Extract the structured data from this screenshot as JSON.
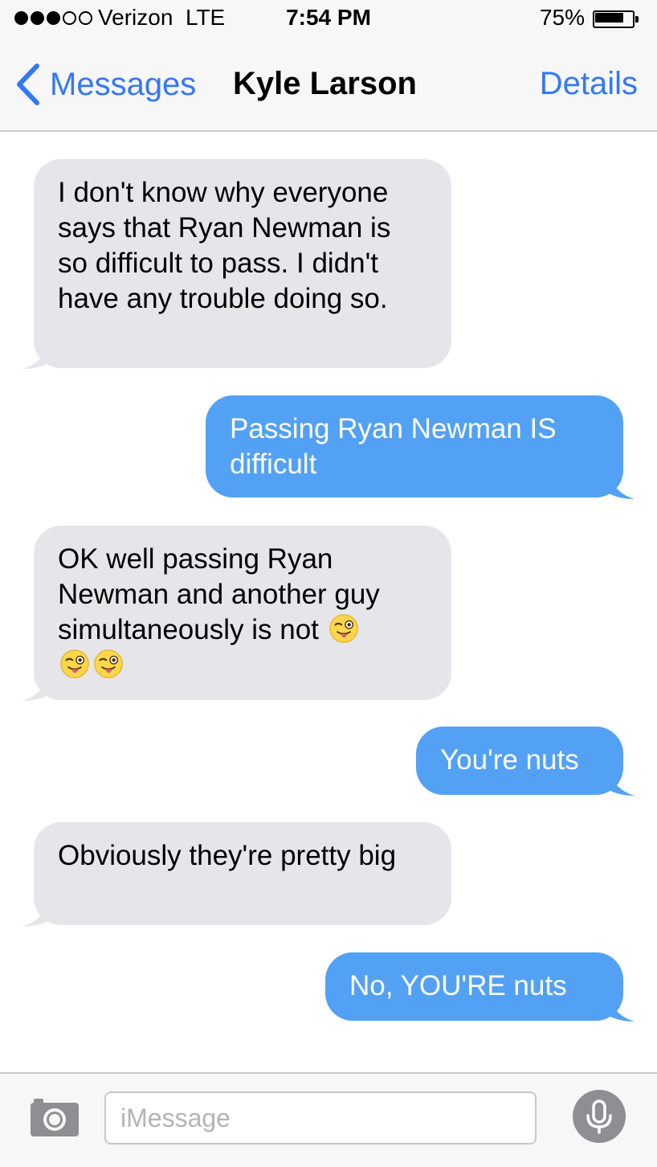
{
  "status_bar": {
    "signal_filled": 3,
    "signal_total": 5,
    "carrier": "Verizon  LTE",
    "time": "7:54 PM",
    "battery_percent": "75%",
    "battery_level": 0.75
  },
  "nav": {
    "back_label": "Messages",
    "contact_name": "Kyle Larson",
    "details_label": "Details"
  },
  "messages": [
    {
      "direction": "incoming",
      "text": "I don't know why everyone says that Ryan Newman is so difficult to pass. I didn't have any trouble doing so."
    },
    {
      "direction": "outgoing",
      "text": "Passing Ryan Newman IS difficult"
    },
    {
      "direction": "incoming",
      "text": "OK well passing Ryan Newman and another guy simultaneously is not",
      "emoji": [
        "winking-face-with-tongue",
        "winking-face-with-tongue",
        "winking-face-with-tongue"
      ]
    },
    {
      "direction": "outgoing",
      "text": "You're nuts"
    },
    {
      "direction": "incoming",
      "text": "Obviously they're pretty big"
    },
    {
      "direction": "outgoing",
      "text": "No, YOU'RE nuts"
    }
  ],
  "input": {
    "placeholder": "iMessage",
    "value": ""
  },
  "colors": {
    "accent": "#3478f6",
    "outgoing_bubble": "#53a1f4",
    "incoming_bubble": "#e5e5ea"
  }
}
